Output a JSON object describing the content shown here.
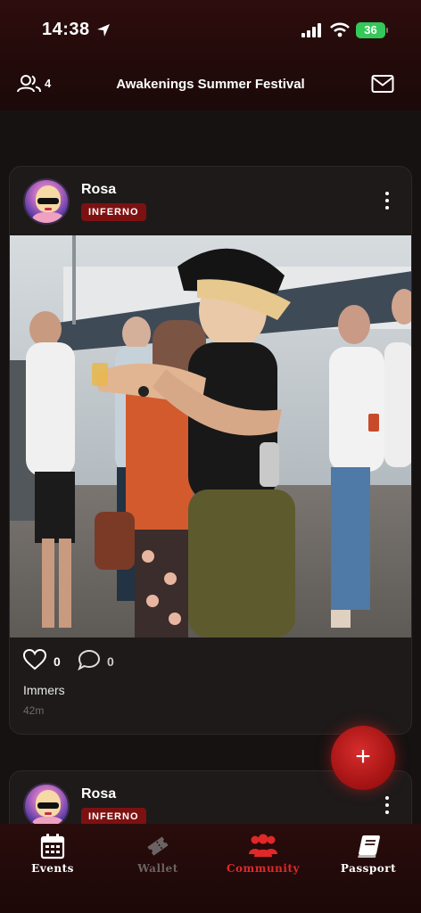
{
  "status_bar": {
    "time": "14:38",
    "battery": "36"
  },
  "header": {
    "friends_count": "4",
    "title": "Awakenings Summer Festival"
  },
  "posts": [
    {
      "author": "Rosa",
      "badge": "INFERNO",
      "likes": "0",
      "comments": "0",
      "caption": "Immers",
      "time_ago": "42m"
    },
    {
      "author": "Rosa",
      "badge": "INFERNO"
    }
  ],
  "fab": {
    "label": "+"
  },
  "tabs": [
    {
      "label": "Events",
      "icon": "calendar-icon",
      "color": "#ffffff"
    },
    {
      "label": "Wallet",
      "icon": "ticket-icon",
      "color": "#6b6363"
    },
    {
      "label": "Community",
      "icon": "people-icon",
      "color": "#e02828"
    },
    {
      "label": "Passport",
      "icon": "book-icon",
      "color": "#ffffff"
    }
  ],
  "colors": {
    "accent": "#e02828",
    "badge": "#7d1111",
    "battery": "#34c759"
  }
}
